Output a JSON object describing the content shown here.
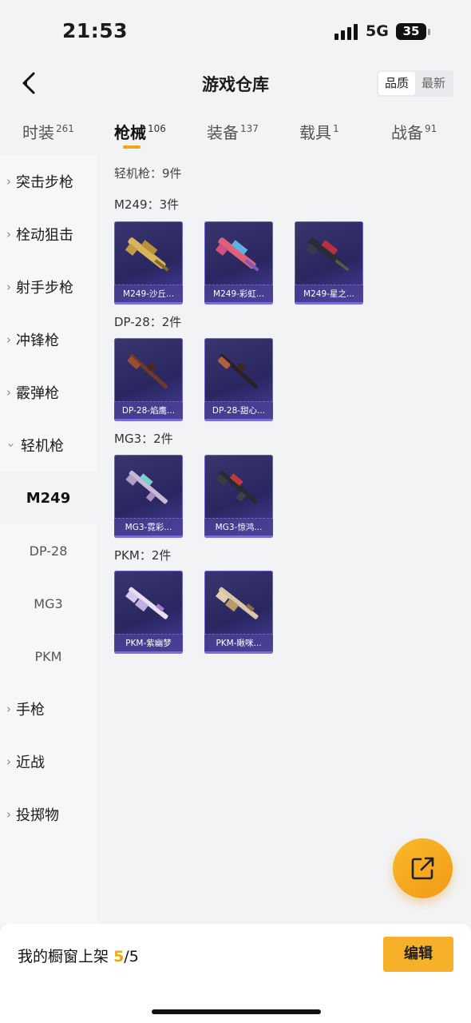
{
  "status": {
    "time": "21:53",
    "network": "5G",
    "battery": "35"
  },
  "header": {
    "title": "游戏仓库",
    "sort_options": [
      "品质",
      "最新"
    ],
    "sort_active": "品质"
  },
  "tabs": [
    {
      "label": "时装",
      "count": "261"
    },
    {
      "label": "枪械",
      "count": "106"
    },
    {
      "label": "装备",
      "count": "137"
    },
    {
      "label": "载具",
      "count": "1"
    },
    {
      "label": "战备",
      "count": "91"
    }
  ],
  "sidebar": {
    "items": [
      {
        "label": "突击步枪",
        "expanded": false
      },
      {
        "label": "栓动狙击",
        "expanded": false
      },
      {
        "label": "射手步枪",
        "expanded": false
      },
      {
        "label": "冲锋枪",
        "expanded": false
      },
      {
        "label": "霰弹枪",
        "expanded": false
      },
      {
        "label": "轻机枪",
        "expanded": true
      },
      {
        "label": "M249",
        "sub": true,
        "selected": true
      },
      {
        "label": "DP-28",
        "sub": true
      },
      {
        "label": "MG3",
        "sub": true
      },
      {
        "label": "PKM",
        "sub": true
      },
      {
        "label": "手枪",
        "expanded": false
      },
      {
        "label": "近战",
        "expanded": false
      },
      {
        "label": "投掷物",
        "expanded": false
      }
    ]
  },
  "main": {
    "summary": "轻机枪：9件",
    "groups": [
      {
        "title": "M249：3件",
        "items": [
          "M249-沙丘...",
          "M249-彩虹...",
          "M249-星之..."
        ]
      },
      {
        "title": "DP-28：2件",
        "items": [
          "DP-28-焰鹰...",
          "DP-28-甜心..."
        ]
      },
      {
        "title": "MG3：2件",
        "items": [
          "MG3-霓彩...",
          "MG3-惊鸿..."
        ]
      },
      {
        "title": "PKM：2件",
        "items": [
          "PKM-紫幽梦",
          "PKM-瞅咪..."
        ]
      }
    ]
  },
  "bottom": {
    "showcase_label": "我的橱窗上架",
    "showcase_current": "5",
    "showcase_total": "/5",
    "edit_label": "编辑"
  },
  "colors": {
    "accent": "#f3a517",
    "card_bg": "#2a2660",
    "card_border": "#6b5fd4"
  }
}
